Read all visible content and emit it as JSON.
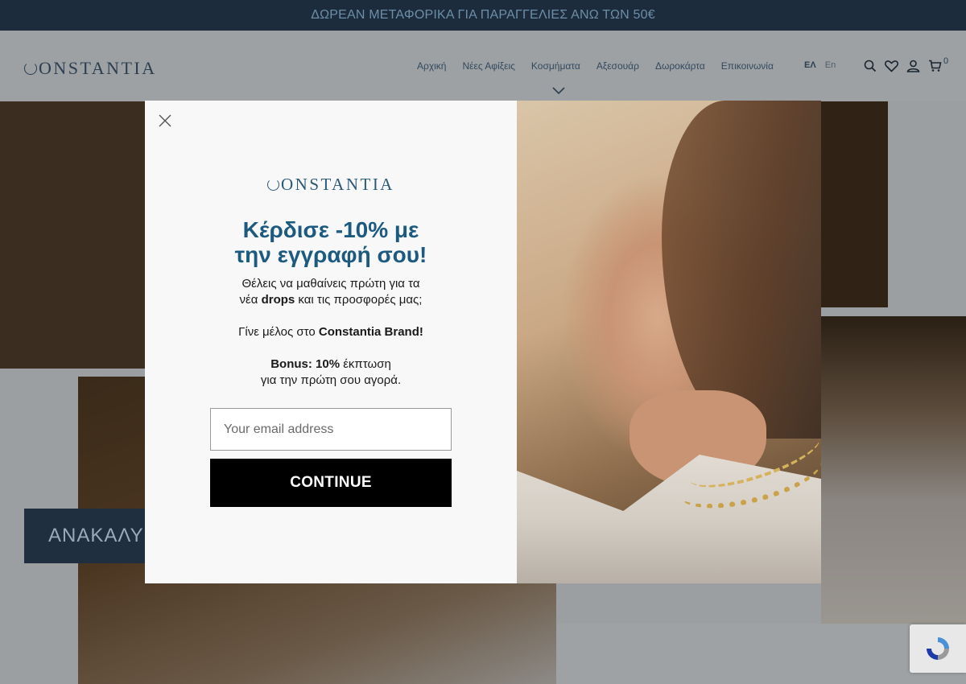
{
  "announcement": {
    "text": "ΔΩΡΕΑΝ ΜΕΤΑΦΟΡΙΚΑ ΓΙΑ ΠΑΡΑΓΓΕΛΙΕΣ ΑΝΩ ΤΩΝ 50€"
  },
  "header": {
    "logo": "ONSTANTIA",
    "nav": [
      "Αρχική",
      "Νέες Αφίξεις",
      "Κοσμήματα",
      "Αξεσουάρ",
      "Δωροκάρτα",
      "Επικοινωνία"
    ],
    "lang_active": "ΕΛ",
    "lang_other": "En",
    "cart_count": "0",
    "icons": [
      "search-icon",
      "heart-icon",
      "user-icon",
      "cart-icon",
      "chevron-down-icon"
    ]
  },
  "hero": {
    "cta_text": "ΑΝΑΚΑΛΥ"
  },
  "modal": {
    "logo": "ONSTANTIA",
    "headline_line1": "Κέρδισε -10% με",
    "headline_line2": "την εγγραφή σου!",
    "body": {
      "p1_line1": "Θέλεις να μαθαίνεις πρώτη για τα",
      "p1_line2_pre": "νέα ",
      "p1_line2_bold": "drops",
      "p1_line2_post": " και τις προσφορές μας;",
      "p2_pre": "Γίνε μέλος στο ",
      "p2_bold": "Constantia Brand!",
      "p3_bold": "Bonus: 10%",
      "p3_post": " έκπτωση",
      "p3_line2": "για την πρώτη σου αγορά."
    },
    "email_placeholder": "Your email address",
    "email_value": "",
    "continue_label": "CONTINUE"
  },
  "colors": {
    "announcement_bg": "#1c2c3c",
    "brand_blue": "#1c5a80",
    "button_bg": "#000000"
  }
}
